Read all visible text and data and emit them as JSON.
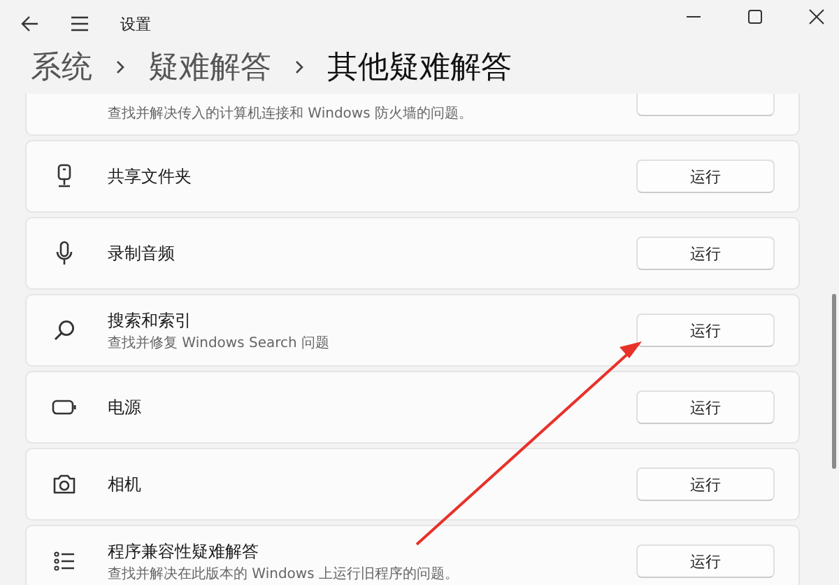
{
  "window": {
    "title": "设置"
  },
  "breadcrumb": [
    {
      "label": "系统",
      "current": false
    },
    {
      "label": "疑难解答",
      "current": false
    },
    {
      "label": "其他疑难解答",
      "current": true
    }
  ],
  "items": [
    {
      "description": "查找并解决传入的计算机连接和 Windows 防火墙的问题。"
    },
    {
      "title": "共享文件夹",
      "button": "运行"
    },
    {
      "title": "录制音频",
      "button": "运行"
    },
    {
      "title": "搜索和索引",
      "description": "查找并修复 Windows Search 问题",
      "button": "运行"
    },
    {
      "title": "电源",
      "button": "运行"
    },
    {
      "title": "相机",
      "button": "运行"
    },
    {
      "title": "程序兼容性疑难解答",
      "description": "查找并解决在此版本的 Windows 上运行旧程序的问题。",
      "button": "运行"
    }
  ]
}
